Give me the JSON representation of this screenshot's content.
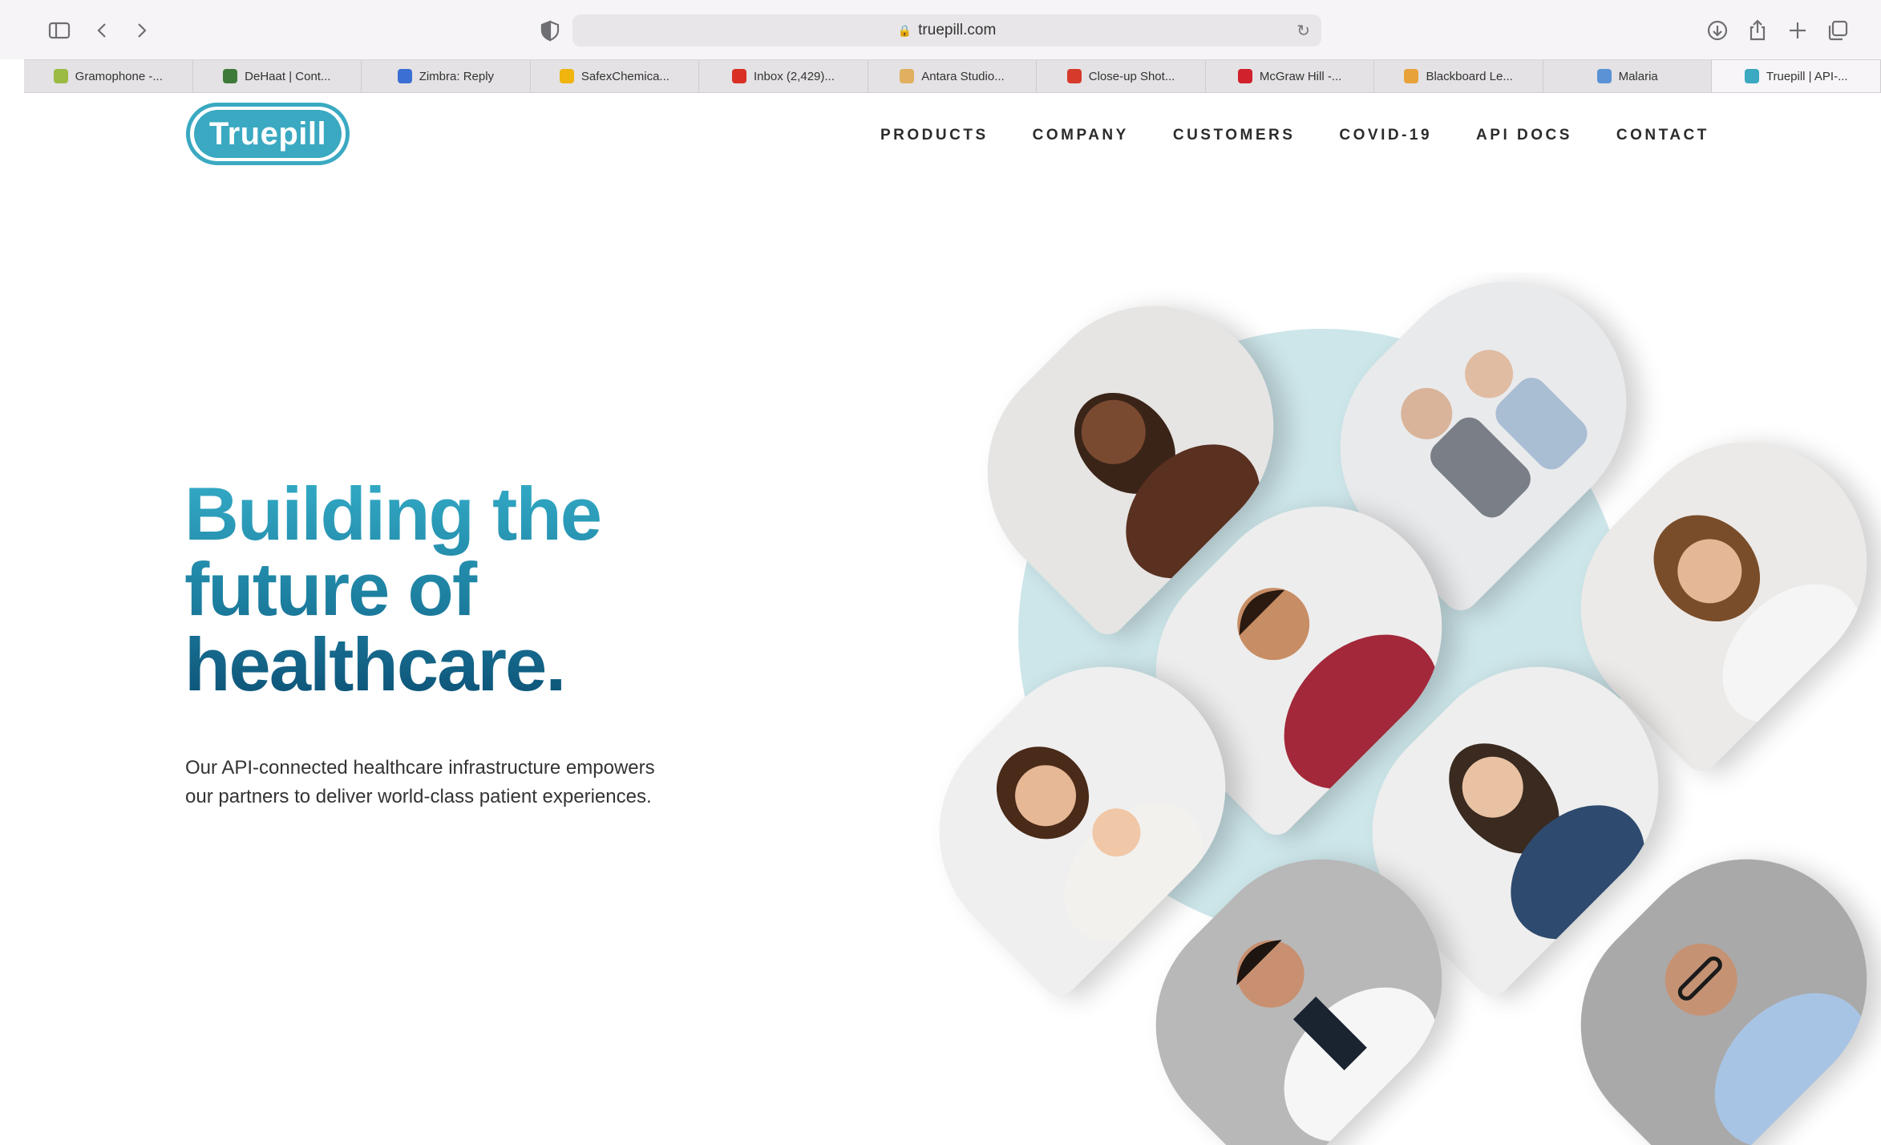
{
  "browser": {
    "url": "truepill.com",
    "tabs": [
      {
        "label": "Gramophone -...",
        "icon": "leaf-icon",
        "color": "#9bbb45"
      },
      {
        "label": "DeHaat | Cont...",
        "icon": "dehaat-icon",
        "color": "#3d7a3a"
      },
      {
        "label": "Zimbra: Reply",
        "icon": "zimbra-icon",
        "color": "#3b6fd4"
      },
      {
        "label": "SafexChemica...",
        "icon": "folder-icon",
        "color": "#f0b40e"
      },
      {
        "label": "Inbox (2,429)...",
        "icon": "gmail-icon",
        "color": "#d93025"
      },
      {
        "label": "Antara Studio...",
        "icon": "sun-icon",
        "color": "#e0b060"
      },
      {
        "label": "Close-up Shot...",
        "icon": "pexels-icon",
        "color": "#d63a2a"
      },
      {
        "label": "McGraw Hill -...",
        "icon": "mcgraw-icon",
        "color": "#d0212c"
      },
      {
        "label": "Blackboard Le...",
        "icon": "blackboard-icon",
        "color": "#e8a23a"
      },
      {
        "label": "Malaria",
        "icon": "who-icon",
        "color": "#5b92d6"
      },
      {
        "label": "Truepill | API-...",
        "icon": "truepill-icon",
        "color": "#3aa9c1"
      }
    ],
    "active_tab": 10
  },
  "site": {
    "logo_text": "Truepill",
    "brand_color": "#3aa9c1",
    "nav": [
      "PRODUCTS",
      "COMPANY",
      "CUSTOMERS",
      "COVID-19",
      "API DOCS",
      "CONTACT"
    ],
    "headline": [
      "Building the",
      "future of",
      "healthcare."
    ],
    "subtext_line1": "Our API-connected healthcare infrastructure empowers",
    "subtext_line2": "our partners to deliver world-class patient experiences."
  }
}
